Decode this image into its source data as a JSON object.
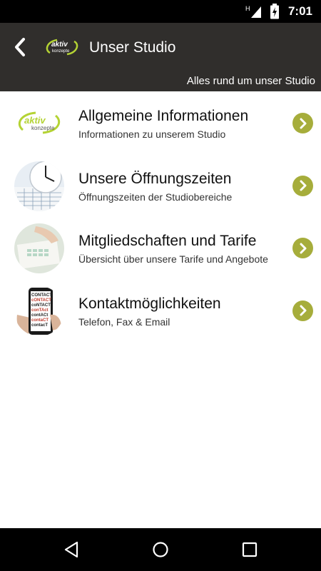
{
  "status_bar": {
    "time": "7:01",
    "network_label": "H",
    "icons": [
      "signal-icon",
      "battery-icon"
    ]
  },
  "app_bar": {
    "title": "Unser Studio",
    "subtitle": "Alles rund um unser Studio",
    "logo_text_top": "aktiv",
    "logo_text_bottom": "konzepte",
    "background": "#302e2c"
  },
  "list": {
    "items": [
      {
        "title": "Allgemeine Informationen",
        "subtitle": "Informationen zu unserem Studio",
        "thumbnail": "aktiv-konzepte-logo",
        "logo_text_top": "aktiv",
        "logo_text_bottom": "konzepte"
      },
      {
        "title": "Unsere Öffnungszeiten",
        "subtitle": "Öffnungszeiten der Studiobereiche",
        "thumbnail": "clock-calendar-image"
      },
      {
        "title": "Mitgliedschaften und Tarife",
        "subtitle": "Übersicht über unsere Tarife und Angebote",
        "thumbnail": "calculator-document-image"
      },
      {
        "title": "Kontaktmöglichkeiten",
        "subtitle": "Telefon, Fax & Email",
        "thumbnail": "contact-phone-image",
        "thumb_words": [
          "CONTACT",
          "cONTACT",
          "coNTACT",
          "conTAct",
          "contACt",
          "contaCT",
          "contacT"
        ]
      }
    ],
    "chevron_color": "#a6ad3b"
  },
  "nav_bar": {
    "buttons": [
      "back-triangle-icon",
      "home-circle-icon",
      "recents-square-icon"
    ]
  }
}
